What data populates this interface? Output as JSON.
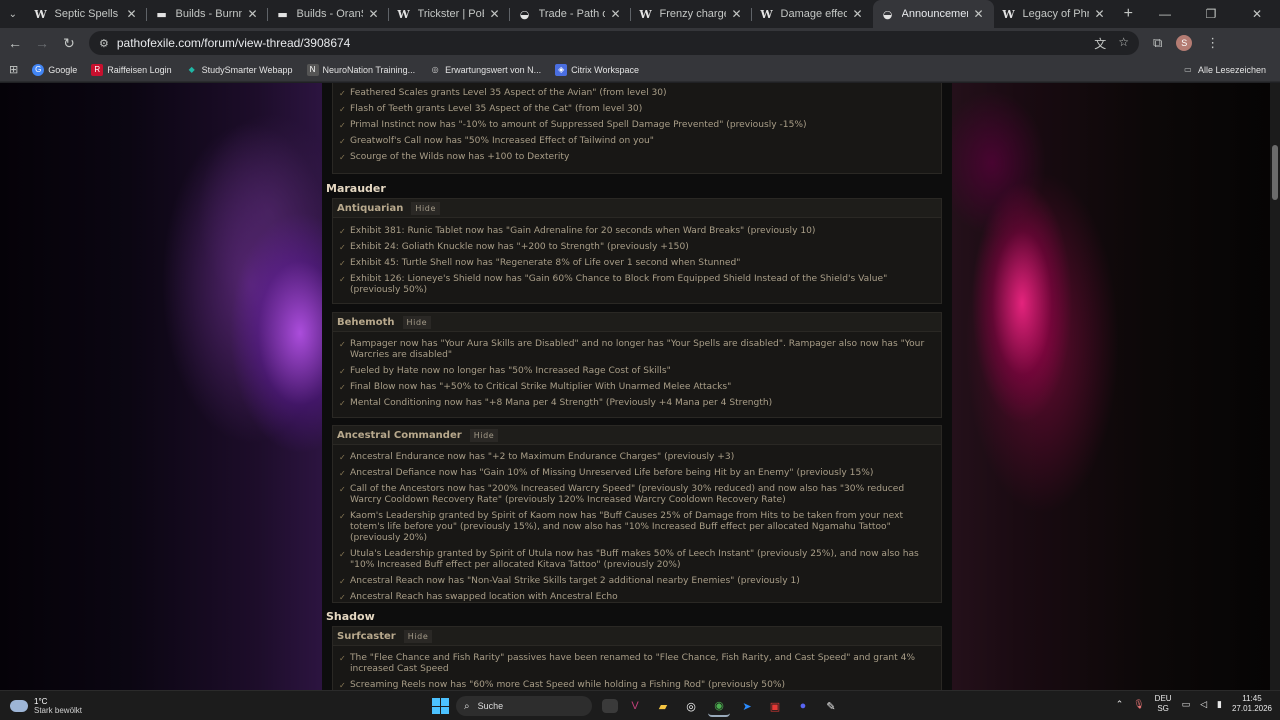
{
  "browser": {
    "tabs": [
      {
        "icon": "W",
        "label": "Septic Spells | PoE Wiki"
      },
      {
        "icon": "▬",
        "label": "Builds - BurnnerKFDu"
      },
      {
        "icon": "▬",
        "label": "Builds - OranSS - Path"
      },
      {
        "icon": "W",
        "label": "Trickster | PoE Wiki"
      },
      {
        "icon": "◒",
        "label": "Trade - Path of Exile"
      },
      {
        "icon": "W",
        "label": "Frenzy charge | PoE W"
      },
      {
        "icon": "W",
        "label": "Damage effectiveness"
      },
      {
        "icon": "◒",
        "label": "Announcements - Eve"
      },
      {
        "icon": "W",
        "label": "Legacy of Phrecia | Pr"
      }
    ],
    "active_tab": 7,
    "url": "pathofexile.com/forum/view-thread/3908674",
    "profile_initial": "S",
    "bookmarks": [
      {
        "label": "Google",
        "icon": "G",
        "color": "#4285f4"
      },
      {
        "label": "Raiffeisen Login",
        "icon": "R",
        "color": "#c8102e"
      },
      {
        "label": "StudySmarter Webapp",
        "icon": "◆",
        "color": "#1fb7a5"
      },
      {
        "label": "NeuroNation Training...",
        "icon": "N",
        "color": "#333333"
      },
      {
        "label": "Erwartungswert von N...",
        "icon": "◎",
        "color": "#666666"
      },
      {
        "label": "Citrix Workspace",
        "icon": "◈",
        "color": "#4a6ee0"
      }
    ],
    "bookmarks_right": "Alle Lesezeichen"
  },
  "page": {
    "top_box": {
      "items": [
        "Feathered Scales grants Level 35 Aspect of the Avian\" (from level 30)",
        "Flash of Teeth grants Level 35 Aspect of the Cat\" (from level 30)",
        "Primal Instinct now has \"-10% to amount of Suppressed Spell Damage Prevented\" (previously -15%)",
        "Greatwolf's Call now has \"50% Increased Effect of Tailwind on you\"",
        "Scourge of the Wilds now has +100 to Dexterity"
      ]
    },
    "marauder": {
      "heading": "Marauder",
      "hide_label": "Hide",
      "boxes": [
        {
          "title": "Antiquarian",
          "items": [
            "Exhibit 381: Runic Tablet now has \"Gain Adrenaline for 20 seconds when Ward Breaks\" (previously 10)",
            "Exhibit 24: Goliath Knuckle now has \"+200 to Strength\" (previously +150)",
            "Exhibit 45: Turtle Shell now has \"Regenerate 8% of Life over 1 second when Stunned\"",
            "Exhibit 126: Lioneye's Shield now has \"Gain 60% Chance to Block From Equipped Shield Instead of the Shield's Value\" (previously 50%)"
          ]
        },
        {
          "title": "Behemoth",
          "items": [
            "Rampager now has \"Your Aura Skills are Disabled\" and no longer has \"Your Spells are disabled\". Rampager also now has \"Your Warcries are disabled\"",
            "Fueled by Hate now no longer has \"50% Increased Rage Cost of Skills\"",
            "Final Blow now has \"+50% to Critical Strike Multiplier With Unarmed Melee Attacks\"",
            "Mental Conditioning now has \"+8 Mana per 4 Strength\" (Previously +4 Mana per 4 Strength)"
          ]
        },
        {
          "title": "Ancestral Commander",
          "items": [
            "Ancestral Endurance now has \"+2 to Maximum Endurance Charges\" (previously +3)",
            "Ancestral Defiance now has \"Gain 10% of Missing Unreserved Life before being Hit by an Enemy\" (previously 15%)",
            "Call of the Ancestors now has \"200% Increased Warcry Speed\" (previously 30% reduced) and now also has \"30% reduced Warcry Cooldown Recovery Rate\" (previously 120% Increased Warcry Cooldown Recovery Rate)",
            "Kaom's Leadership granted by Spirit of Kaom now has \"Buff Causes 25% of Damage from Hits to be taken from your next totem's life before you\" (previously 15%), and now also has \"10% Increased Buff effect per allocated Ngamahu Tattoo\" (previously 20%)",
            "Utula's Leadership granted by Spirit of Utula now has \"Buff makes 50% of Leech Instant\" (previously 25%), and now also has \"10% Increased Buff effect per allocated Kitava Tattoo\" (previously 20%)",
            "Ancestral Reach now has \"Non-Vaal Strike Skills target 2 additional nearby Enemies\" (previously 1)",
            "Ancestral Reach has swapped location with Ancestral Echo"
          ]
        }
      ]
    },
    "shadow": {
      "heading": "Shadow",
      "boxes": [
        {
          "title": "Surfcaster",
          "items": [
            "The \"Flee Chance and Fish Rarity\" passives have been renamed to \"Flee Chance, Fish Rarity, and Cast Speed\" and grant 4% increased Cast Speed",
            "Screaming Reels now has \"60% more Cast Speed while holding a Fishing Rod\" (previously 50%)"
          ]
        }
      ]
    }
  },
  "taskbar": {
    "weather_temp": "1°C",
    "weather_desc": "Stark bewölkt",
    "search_label": "Suche",
    "lang_top": "DEU",
    "lang_bottom": "SG",
    "time": "11:45",
    "date": "27.01.2026"
  }
}
